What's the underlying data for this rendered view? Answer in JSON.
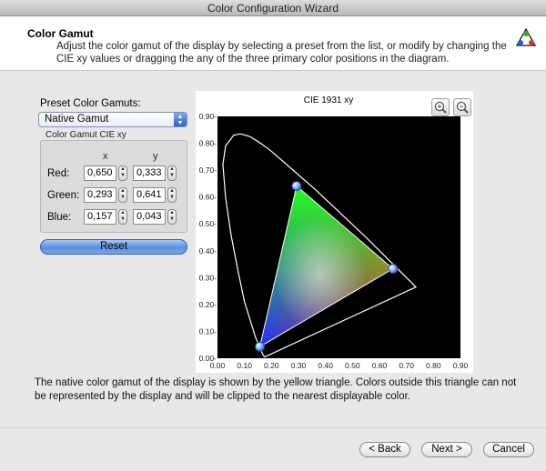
{
  "window": {
    "title": "Color Configuration Wizard"
  },
  "header": {
    "title": "Color Gamut",
    "description": "Adjust the color gamut of the display by selecting a preset from the list, or modify by changing the CIE xy values or dragging the any of the three primary color positions in the diagram.",
    "icon": "color-wheel-icon"
  },
  "preset": {
    "label": "Preset Color Gamuts:",
    "selected": "Native Gamut"
  },
  "gamut": {
    "label": "Color Gamut CIE xy",
    "col_x": "x",
    "col_y": "y",
    "rows": [
      {
        "label": "Red:",
        "x": "0,650",
        "y": "0,333"
      },
      {
        "label": "Green:",
        "x": "0,293",
        "y": "0,641"
      },
      {
        "label": "Blue:",
        "x": "0,157",
        "y": "0,043"
      }
    ]
  },
  "reset_label": "Reset",
  "chart_data": {
    "type": "scatter",
    "title": "CIE 1931 xy",
    "xlim": [
      0,
      0.9
    ],
    "ylim": [
      0,
      0.9
    ],
    "xticks": [
      "0.00",
      "0.10",
      "0.20",
      "0.30",
      "0.40",
      "0.50",
      "0.60",
      "0.70",
      "0.80",
      "0.90"
    ],
    "yticks": [
      "0.00-",
      "0.10-",
      "0.20-",
      "0.30-",
      "0.40-",
      "0.50-",
      "0.60-",
      "0.70-",
      "0.80-",
      "0.90-"
    ],
    "triangle": {
      "red": [
        0.65,
        0.333
      ],
      "green": [
        0.293,
        0.641
      ],
      "blue": [
        0.157,
        0.043
      ]
    },
    "locus": [
      [
        0.175,
        0.005
      ],
      [
        0.17,
        0.01
      ],
      [
        0.165,
        0.02
      ],
      [
        0.155,
        0.045
      ],
      [
        0.14,
        0.08
      ],
      [
        0.125,
        0.13
      ],
      [
        0.1,
        0.21
      ],
      [
        0.075,
        0.33
      ],
      [
        0.05,
        0.46
      ],
      [
        0.03,
        0.6
      ],
      [
        0.02,
        0.72
      ],
      [
        0.03,
        0.79
      ],
      [
        0.06,
        0.83
      ],
      [
        0.085,
        0.835
      ],
      [
        0.12,
        0.825
      ],
      [
        0.16,
        0.8
      ],
      [
        0.2,
        0.77
      ],
      [
        0.28,
        0.7
      ],
      [
        0.36,
        0.63
      ],
      [
        0.45,
        0.545
      ],
      [
        0.55,
        0.45
      ],
      [
        0.64,
        0.36
      ],
      [
        0.735,
        0.265
      ],
      [
        0.175,
        0.005
      ]
    ],
    "background": "#000000",
    "grid": false
  },
  "note": "The native color gamut of the display is shown by the yellow triangle. Colors outside this triangle can not be represented by the display and will be clipped to the nearest displayable color.",
  "footer": {
    "back": "< Back",
    "next": "Next >",
    "cancel": "Cancel"
  },
  "icons": {
    "zoom_in": "zoom-in-icon",
    "zoom_out": "zoom-out-icon"
  }
}
